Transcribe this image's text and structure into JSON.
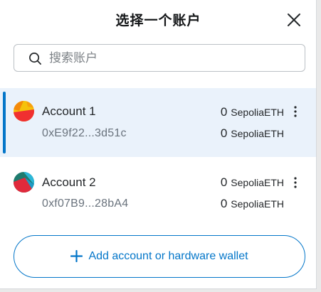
{
  "dialog": {
    "title": "选择一个账户",
    "close_icon": "close-icon"
  },
  "search": {
    "placeholder": "搜索账户",
    "value": "",
    "icon": "search-icon"
  },
  "accounts": [
    {
      "name": "Account 1",
      "address": "0xE9f22...3d51c",
      "balance_top": "0",
      "unit_top": "SepoliaETH",
      "balance_bottom": "0",
      "unit_bottom": "SepoliaETH",
      "selected": true,
      "menu_icon": "more-vertical-icon"
    },
    {
      "name": "Account 2",
      "address": "0xf07B9...28bA4",
      "balance_top": "0",
      "unit_top": "SepoliaETH",
      "balance_bottom": "0",
      "unit_bottom": "SepoliaETH",
      "selected": false,
      "menu_icon": "more-vertical-icon"
    }
  ],
  "add_button": {
    "label": "Add account or hardware wallet",
    "icon": "plus-icon"
  },
  "colors": {
    "accent": "#0376c9",
    "selected_bg": "#eaf2fb",
    "text_primary": "#24272a",
    "text_muted": "#6a737d",
    "border": "#bbc0c5"
  }
}
